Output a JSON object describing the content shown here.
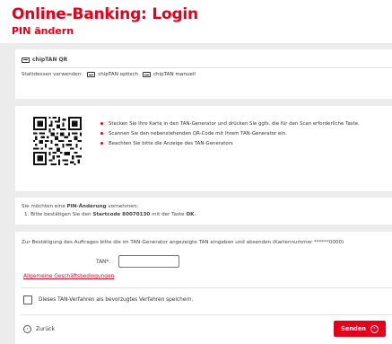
{
  "header": {
    "title": "Online-Banking: Login",
    "subtitle": "PIN ändern"
  },
  "method": {
    "current_label": "chipTAN QR",
    "alternatives_prefix": "Stattdessen verwenden:",
    "alternatives": [
      "chipTAN optisch",
      "chipTAN manuell"
    ]
  },
  "instructions": {
    "bullets": [
      "Stecken Sie Ihre Karte in den TAN-Generator und drücken Sie ggfs. die für den Scan erforderliche Taste.",
      "Scannen Sie den nebenstehenden QR-Code mit Ihrem TAN-Generator ein.",
      "Beachten Sie bitte die Anzeige des TAN-Generators"
    ],
    "qr_icon": "qr-code"
  },
  "order": {
    "intro_pre": "Sie möchten eine ",
    "intro_bold": "PIN-Änderung",
    "intro_post": " vornehmen:",
    "step_pre": "1. Bitte bestätigen Sie den ",
    "step_bold": "Startcode 80070130",
    "step_mid": " mit der Taste ",
    "step_key": "OK",
    "step_end": "."
  },
  "form": {
    "confirm_text": "Zur Bestätigung des Auftrages bitte die im TAN-Generator angezeigte TAN eingeben und absenden (Kartennummer ******0000)",
    "tan_label": "TAN*:",
    "tan_value": "",
    "agb_link": "Allgemeine Geschäftsbedingungen",
    "save_checkbox_label": "Dieses TAN-Verfahren als bevorzugtes Verfahren speichern.",
    "save_checked": false,
    "back_label": "Zurück",
    "send_label": "Senden"
  },
  "colors": {
    "brand": "#e2001a",
    "background": "#ececec"
  }
}
